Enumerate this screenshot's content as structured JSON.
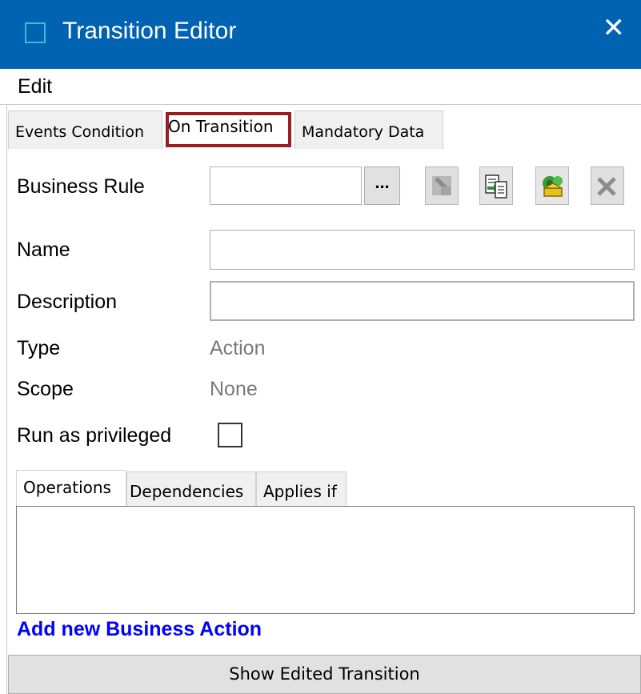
{
  "window": {
    "title": "Transition Editor",
    "close_glyph": "✕",
    "icon": "window-icon"
  },
  "menu": {
    "edit": "Edit"
  },
  "tabs": [
    {
      "label": "Events Condition",
      "selected": false
    },
    {
      "label": "On Transition",
      "selected": true
    },
    {
      "label": "Mandatory Data",
      "selected": false
    }
  ],
  "form": {
    "business_rule": {
      "label": "Business Rule",
      "value": "",
      "browse_label": "..."
    },
    "name": {
      "label": "Name",
      "value": ""
    },
    "description": {
      "label": "Description",
      "value": ""
    },
    "type": {
      "label": "Type",
      "value": "Action"
    },
    "scope": {
      "label": "Scope",
      "value": "None"
    },
    "run_as_privileged": {
      "label": "Run as privileged",
      "checked": false
    }
  },
  "toolbar": [
    {
      "icon": "edit-rule-icon",
      "enabled": false
    },
    {
      "icon": "copy-rule-icon",
      "enabled": true
    },
    {
      "icon": "new-rule-icon",
      "enabled": true
    },
    {
      "icon": "remove-rule-icon",
      "enabled": false
    }
  ],
  "inner_tabs": [
    {
      "label": "Operations",
      "selected": true
    },
    {
      "label": "Dependencies",
      "selected": false
    },
    {
      "label": "Applies if",
      "selected": false
    }
  ],
  "add_link": "Add new Business Action",
  "bottom_button": "Show Edited Transition",
  "colors": {
    "titlebar": "#0063b1",
    "focus_border": "#9b1c21",
    "link": "#0000ff"
  }
}
